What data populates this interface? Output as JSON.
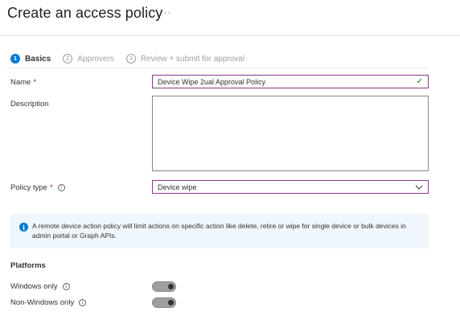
{
  "header": {
    "title": "Create an access policy",
    "more_label": "···"
  },
  "steps": [
    {
      "number": "1",
      "label": "Basics",
      "state": "active"
    },
    {
      "number": "2",
      "label": "Approvers",
      "state": "inactive"
    },
    {
      "number": "3",
      "label": "Review + submit for approval",
      "state": "inactive"
    }
  ],
  "form": {
    "name_label": "Name",
    "name_required": "*",
    "name_value": "Device Wipe 2ual Approval Policy",
    "description_label": "Description",
    "description_value": "",
    "policy_type_label": "Policy type",
    "policy_type_required": "*",
    "policy_type_value": "Device wipe"
  },
  "info_banner": {
    "text": "A remote device action policy will limit actions on specific action like delete, retire or wipe for single device or bulk devices in admin portal or Graph APIs."
  },
  "platforms": {
    "title": "Platforms",
    "windows_only_label": "Windows only",
    "non_windows_only_label": "Non-Windows only"
  },
  "colors": {
    "accent": "#0078d4",
    "focus_border": "#8a3a8a",
    "valid_check": "#107c10",
    "banner_bg": "#eff6fc"
  }
}
